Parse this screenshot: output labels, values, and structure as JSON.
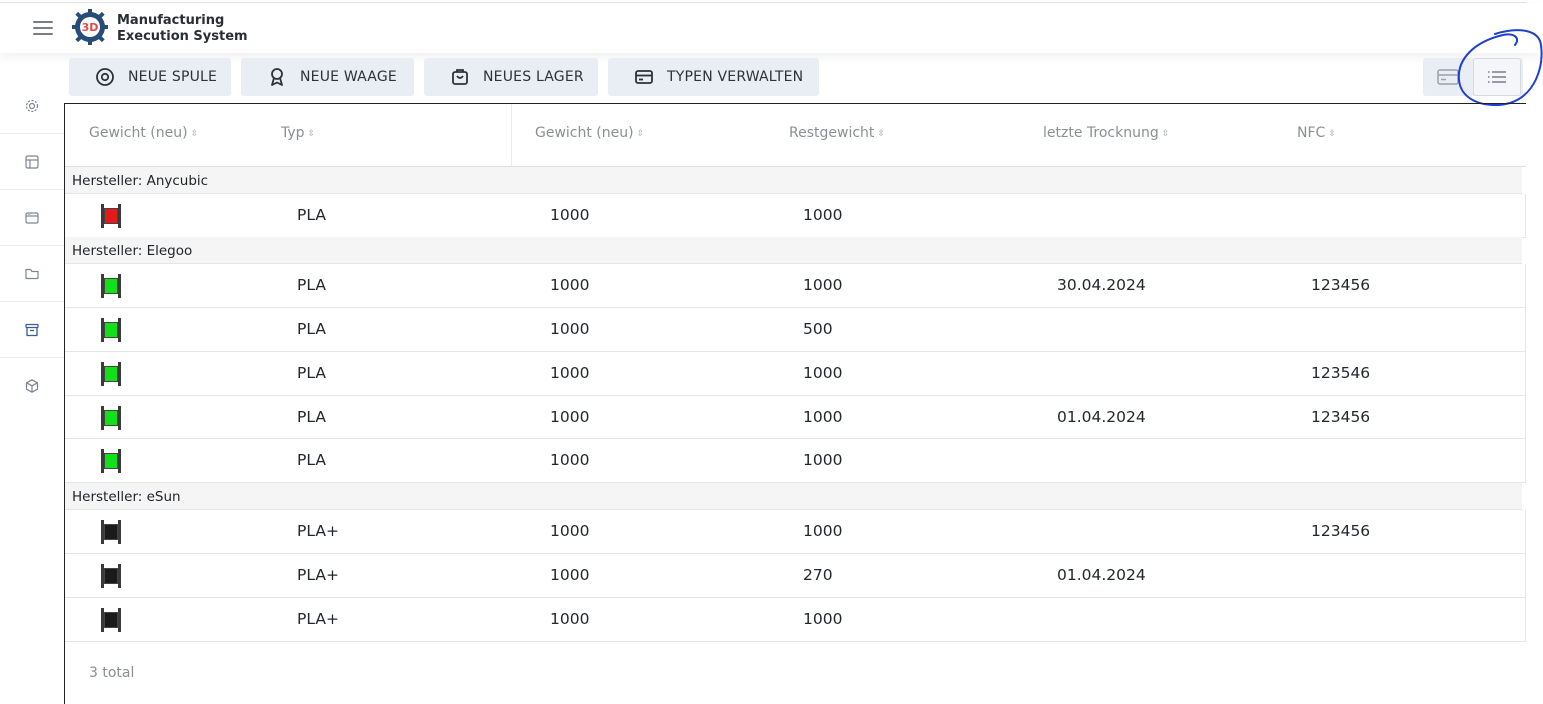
{
  "app": {
    "title_line1": "Manufacturing",
    "title_line2": "Execution System",
    "logo_text": "3D"
  },
  "sidebar": {
    "items": [
      "gear-icon",
      "layout-icon",
      "window-icon",
      "folder-icon",
      "archive-icon",
      "cube-icon"
    ],
    "active_index": 4
  },
  "toolbar": {
    "buttons": [
      {
        "label": "NEUE SPULE",
        "icon": "target-icon"
      },
      {
        "label": "NEUE WAAGE",
        "icon": "award-icon"
      },
      {
        "label": "NEUES LAGER",
        "icon": "basket-icon"
      },
      {
        "label": "TYPEN VERWALTEN",
        "icon": "card-icon"
      }
    ]
  },
  "view_toggle": {
    "options": [
      "card-view-icon",
      "list-view-icon"
    ],
    "selected": "list-view-icon"
  },
  "table": {
    "columns": [
      "Gewicht (neu)",
      "Typ",
      "Gewicht (neu)",
      "Restgewicht",
      "letzte Trocknung",
      "NFC"
    ],
    "groups": [
      {
        "label": "Hersteller: Anycubic",
        "rows": [
          {
            "color": "#e21a1a",
            "typ": "PLA",
            "gewicht": "1000",
            "rest": "1000",
            "trocknung": "",
            "nfc": ""
          }
        ]
      },
      {
        "label": "Hersteller: Elegoo",
        "rows": [
          {
            "color": "#11e11a",
            "typ": "PLA",
            "gewicht": "1000",
            "rest": "1000",
            "trocknung": "30.04.2024",
            "nfc": "123456"
          },
          {
            "color": "#11e11a",
            "typ": "PLA",
            "gewicht": "1000",
            "rest": "500",
            "trocknung": "",
            "nfc": ""
          },
          {
            "color": "#11e11a",
            "typ": "PLA",
            "gewicht": "1000",
            "rest": "1000",
            "trocknung": "",
            "nfc": "123546"
          },
          {
            "color": "#11e11a",
            "typ": "PLA",
            "gewicht": "1000",
            "rest": "1000",
            "trocknung": "01.04.2024",
            "nfc": "123456"
          },
          {
            "color": "#11e11a",
            "typ": "PLA",
            "gewicht": "1000",
            "rest": "1000",
            "trocknung": "",
            "nfc": ""
          }
        ]
      },
      {
        "label": "Hersteller: eSun",
        "rows": [
          {
            "color": "#1a1a1a",
            "typ": "PLA+",
            "gewicht": "1000",
            "rest": "1000",
            "trocknung": "",
            "nfc": "123456"
          },
          {
            "color": "#1a1a1a",
            "typ": "PLA+",
            "gewicht": "1000",
            "rest": "270",
            "trocknung": "01.04.2024",
            "nfc": ""
          },
          {
            "color": "#1a1a1a",
            "typ": "PLA+",
            "gewicht": "1000",
            "rest": "1000",
            "trocknung": "",
            "nfc": ""
          }
        ]
      }
    ],
    "footer": "3 total"
  },
  "colors": {
    "button_bg": "#e9eef4",
    "group_bg": "#f5f5f5",
    "annotation": "#1f3fd0",
    "active_sidebar": "#3b5e8c"
  }
}
